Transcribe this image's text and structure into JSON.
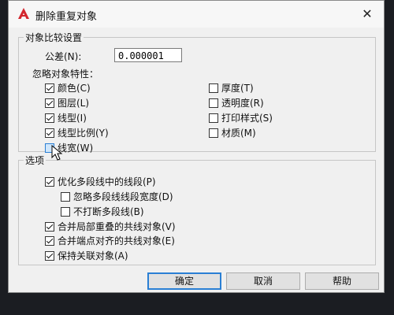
{
  "window": {
    "title": "删除重复对象",
    "close_glyph": "✕"
  },
  "compare_settings": {
    "group_label": "对象比较设置",
    "tolerance_label": "公差(N):",
    "tolerance_value": "0.000001",
    "ignore_label": "忽略对象特性：",
    "properties_left": [
      {
        "label": "颜色(C)",
        "checked": true
      },
      {
        "label": "图层(L)",
        "checked": true
      },
      {
        "label": "线型(I)",
        "checked": true
      },
      {
        "label": "线型比例(Y)",
        "checked": true
      },
      {
        "label": "线宽(W)",
        "checked": false
      }
    ],
    "properties_right": [
      {
        "label": "厚度(T)",
        "checked": false
      },
      {
        "label": "透明度(R)",
        "checked": false
      },
      {
        "label": "打印样式(S)",
        "checked": false
      },
      {
        "label": "材质(M)",
        "checked": false
      }
    ]
  },
  "options": {
    "group_label": "选项",
    "optimize": {
      "label": "优化多段线中的线段(P)",
      "checked": true
    },
    "ignore_width": {
      "label": "忽略多段线线段宽度(D)",
      "checked": false
    },
    "no_break": {
      "label": "不打断多段线(B)",
      "checked": false
    },
    "merge_overlap": {
      "label": "合并局部重叠的共线对象(V)",
      "checked": true
    },
    "merge_endpoint": {
      "label": "合并端点对齐的共线对象(E)",
      "checked": true
    },
    "keep_assoc": {
      "label": "保持关联对象(A)",
      "checked": true
    }
  },
  "buttons": {
    "ok": "确定",
    "cancel": "取消",
    "help": "帮助"
  },
  "colors": {
    "accent": "#2a7fd4",
    "icon_red": "#d3262e"
  }
}
